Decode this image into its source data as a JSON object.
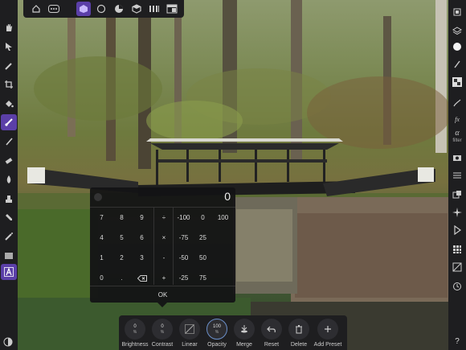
{
  "keypad": {
    "display_value": "0",
    "digits": [
      "7",
      "8",
      "9",
      "4",
      "5",
      "6",
      "1",
      "2",
      "3",
      "0",
      "."
    ],
    "ops": [
      "÷",
      "×",
      "-",
      "+"
    ],
    "percents_a": [
      "-100",
      "-75",
      "-50",
      "-25"
    ],
    "percents_b": [
      "0",
      "25",
      "50",
      "75"
    ],
    "percent_top_right": "100",
    "ok_label": "OK"
  },
  "bottom_bar": {
    "brightness": {
      "label": "Brightness",
      "value": "0",
      "unit": "%"
    },
    "contrast": {
      "label": "Contrast",
      "value": "0",
      "unit": "%"
    },
    "linear": {
      "label": "Linear"
    },
    "opacity": {
      "label": "Opacity",
      "value": "100",
      "unit": "%"
    },
    "merge": {
      "label": "Merge"
    },
    "reset": {
      "label": "Reset"
    },
    "delete": {
      "label": "Delete"
    },
    "add_preset": {
      "label": "Add Preset"
    }
  },
  "right_toolbar": {
    "fx_label": "fx",
    "filter_label": "filter"
  },
  "help_label": "?",
  "colors": {
    "accent": "#5b3fa8",
    "panel": "#1e1e20",
    "active_ring": "#6a8ec8"
  }
}
